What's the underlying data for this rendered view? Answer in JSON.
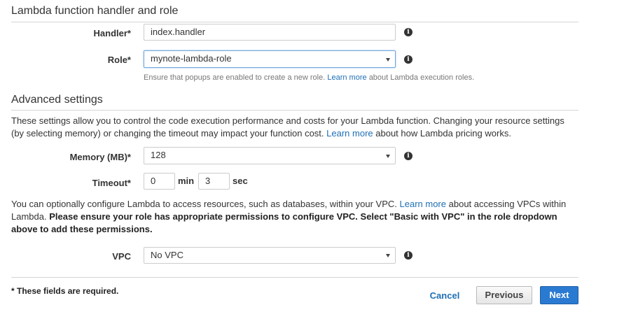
{
  "handler_role": {
    "title": "Lambda function handler and role",
    "handler_label": "Handler*",
    "handler_value": "index.handler",
    "role_label": "Role*",
    "role_value": "mynote-lambda-role",
    "role_hint_prefix": "Ensure that popups are enabled to create a new role.",
    "role_hint_link": "Learn more",
    "role_hint_suffix": "about Lambda execution roles."
  },
  "advanced": {
    "title": "Advanced settings",
    "desc_prefix": "These settings allow you to control the code execution performance and costs for your Lambda function. Changing your resource settings (by selecting memory) or changing the timeout may impact your function cost.",
    "desc_link": "Learn more",
    "desc_suffix": "about how Lambda pricing works.",
    "memory_label": "Memory (MB)*",
    "memory_value": "128",
    "timeout_label": "Timeout*",
    "timeout_min_value": "0",
    "timeout_min_unit": "min",
    "timeout_sec_value": "3",
    "timeout_sec_unit": "sec",
    "vpc_desc_prefix": "You can optionally configure Lambda to access resources, such as databases, within your VPC.",
    "vpc_desc_link": "Learn more",
    "vpc_desc_middle": "about accessing VPCs within Lambda.",
    "vpc_desc_bold": "Please ensure your role has appropriate permissions to configure VPC. Select \"Basic with VPC\" in the role dropdown above to add these permissions.",
    "vpc_label": "VPC",
    "vpc_value": "No VPC"
  },
  "footer": {
    "required_note": "* These fields are required.",
    "cancel_label": "Cancel",
    "previous_label": "Previous",
    "next_label": "Next"
  },
  "icons": {
    "info_glyph": "i"
  }
}
